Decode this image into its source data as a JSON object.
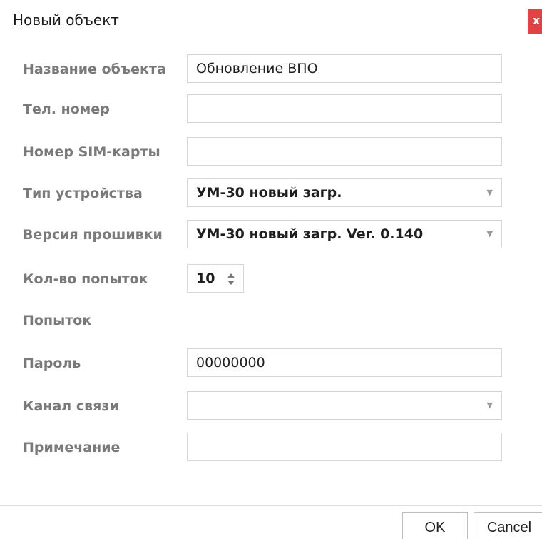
{
  "window": {
    "title": "Новый объект",
    "close_label": "x"
  },
  "form": {
    "object_name": {
      "label": "Название объекта",
      "value": "Обновление ВПО"
    },
    "phone": {
      "label": "Тел. номер",
      "value": ""
    },
    "sim": {
      "label": "Номер SIM-карты",
      "value": ""
    },
    "device_type": {
      "label": "Тип устройства",
      "value": "УМ-30 новый загр."
    },
    "firmware": {
      "label": "Версия прошивки",
      "value": "УМ-30 новый загр. Ver. 0.140"
    },
    "attempts": {
      "label": "Кол-во попыток",
      "value": "10"
    },
    "attempts_caption": {
      "label": "Попыток"
    },
    "password": {
      "label": "Пароль",
      "value": "00000000"
    },
    "channel": {
      "label": "Канал связи",
      "value": ""
    },
    "note": {
      "label": "Примечание",
      "value": ""
    }
  },
  "footer": {
    "ok_label": "OK",
    "cancel_label": "Cancel"
  },
  "colors": {
    "close_button": "#e04343",
    "label_text": "#7a7a7a",
    "border": "#d6d6d6"
  },
  "icons": {
    "dropdown": "triangle-down",
    "spinner": "up-down-arrows"
  }
}
